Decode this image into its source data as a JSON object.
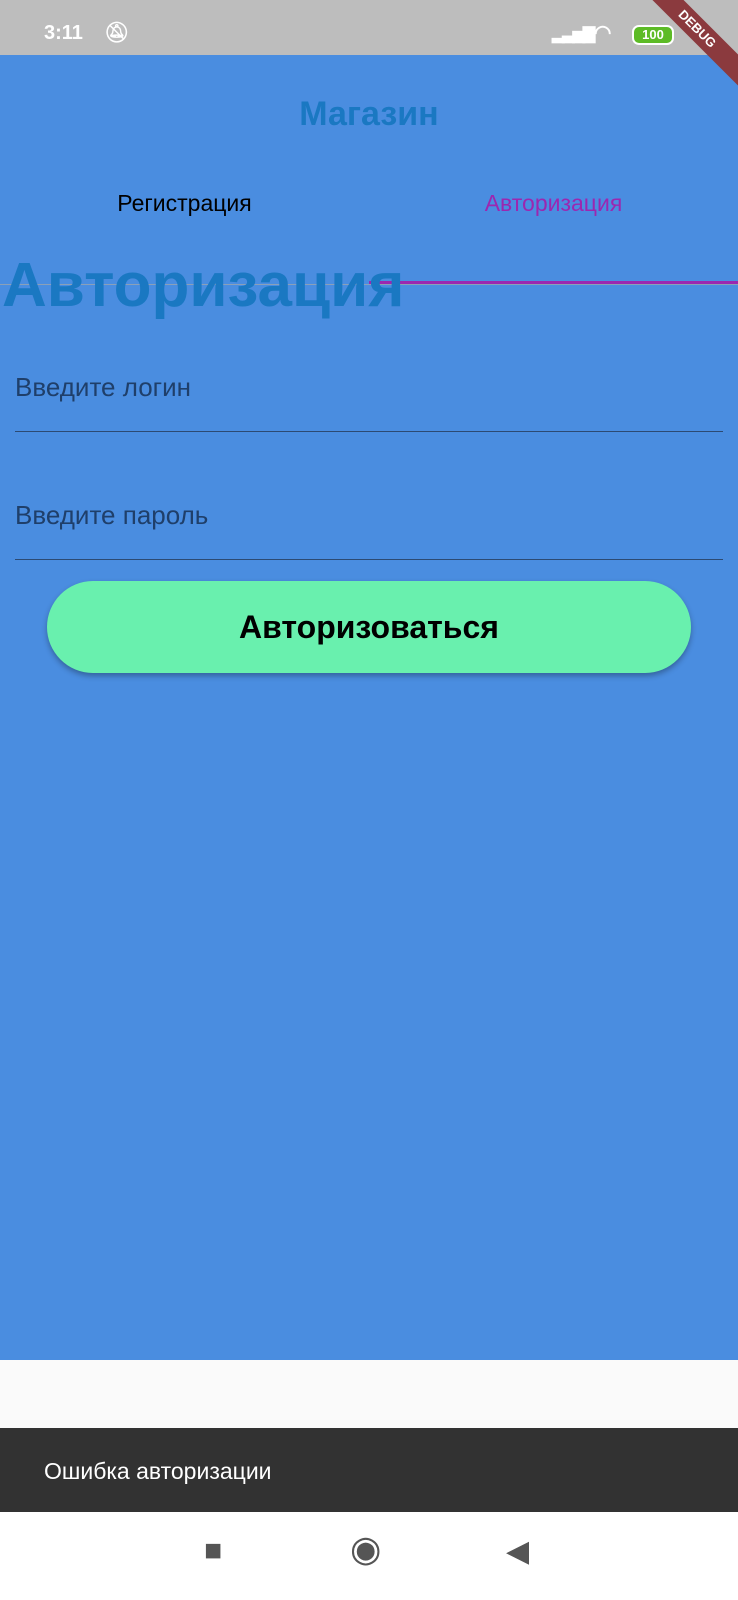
{
  "status_bar": {
    "time": "3:11",
    "battery": "100"
  },
  "debug_banner": "DEBUG",
  "app_bar": {
    "title": "Магазин",
    "tabs": [
      {
        "label": "Регистрация"
      },
      {
        "label": "Авторизация"
      }
    ]
  },
  "page": {
    "heading": "Авторизация",
    "login_placeholder": "Введите логин",
    "password_placeholder": "Введите пароль",
    "submit_label": "Авторизоваться"
  },
  "snackbar": {
    "message": "Ошибка авторизации"
  }
}
